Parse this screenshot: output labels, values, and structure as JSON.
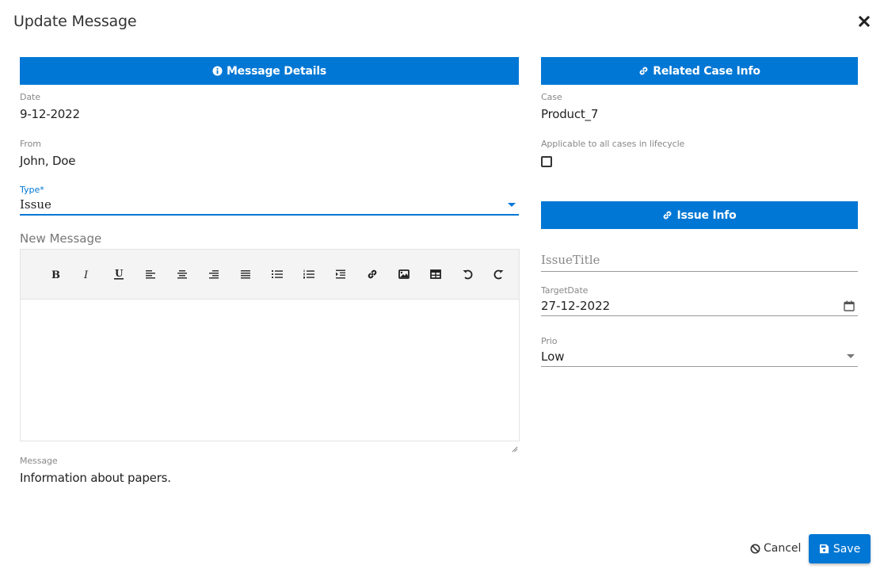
{
  "dialog": {
    "title": "Update Message",
    "close_icon": "close-icon"
  },
  "left": {
    "header": {
      "icon": "info-circle-icon",
      "label": "Message Details"
    },
    "date": {
      "label": "Date",
      "value": "9-12-2022"
    },
    "from": {
      "label": "From",
      "value": "John, Doe"
    },
    "type": {
      "label": "Type*",
      "value": "Issue"
    },
    "new_message": {
      "label": "New Message",
      "value": "",
      "toolbar": [
        "bold",
        "italic",
        "underline",
        "align-left",
        "align-center",
        "align-right",
        "justify",
        "bullet-list",
        "numbered-list",
        "indent",
        "link",
        "image",
        "table",
        "undo",
        "redo"
      ]
    },
    "message": {
      "label": "Message",
      "value": "Information about papers."
    }
  },
  "right": {
    "header": {
      "icon": "link-icon",
      "label": "Related Case Info"
    },
    "case": {
      "label": "Case",
      "value": "Product_7"
    },
    "applicable": {
      "label": "Applicable to all cases in lifecycle",
      "checked": false
    },
    "issue_header": {
      "icon": "link-icon",
      "label": "Issue Info"
    },
    "issue_title": {
      "placeholder": "IssueTitle",
      "value": ""
    },
    "target_date": {
      "label": "TargetDate",
      "value": "27-12-2022"
    },
    "prio": {
      "label": "Prio",
      "value": "Low"
    }
  },
  "footer": {
    "cancel_label": "Cancel",
    "save_label": "Save"
  },
  "colors": {
    "accent": "#0077d4",
    "toolbar_bg": "#f4f4f4"
  }
}
